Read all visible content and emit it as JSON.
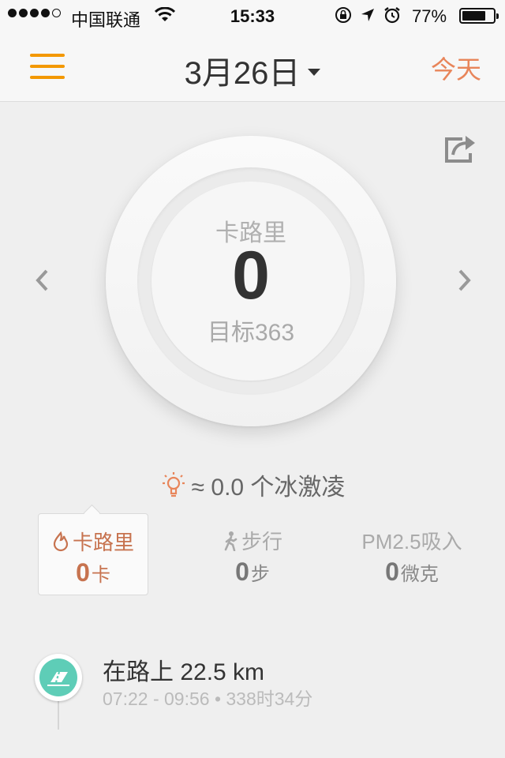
{
  "status_bar": {
    "carrier": "中国联通",
    "time": "15:33",
    "battery_percent_text": "77%",
    "battery_level": 0.77,
    "signal_bars_filled": 4
  },
  "header": {
    "date": "3月26日",
    "today_label": "今天",
    "accent_color": "#f39800"
  },
  "ring": {
    "label": "卡路里",
    "value": "0",
    "goal": "目标363"
  },
  "equivalent": {
    "text": "≈ 0.0 个冰激凌"
  },
  "stats": [
    {
      "title": "卡路里",
      "value": "0",
      "unit": "卡",
      "icon": "flame-icon",
      "active": true,
      "color": "#c7734f"
    },
    {
      "title": "步行",
      "value": "0",
      "unit": "步",
      "icon": "walker-icon",
      "active": false
    },
    {
      "title": "PM2.5吸入",
      "value": "0",
      "unit": "微克",
      "icon": "",
      "active": false
    }
  ],
  "timeline": {
    "title": "在路上 22.5 km",
    "subtitle": "07:22 - 09:56 • 338时34分",
    "icon": "road-icon",
    "icon_color": "#5ecdb7"
  }
}
